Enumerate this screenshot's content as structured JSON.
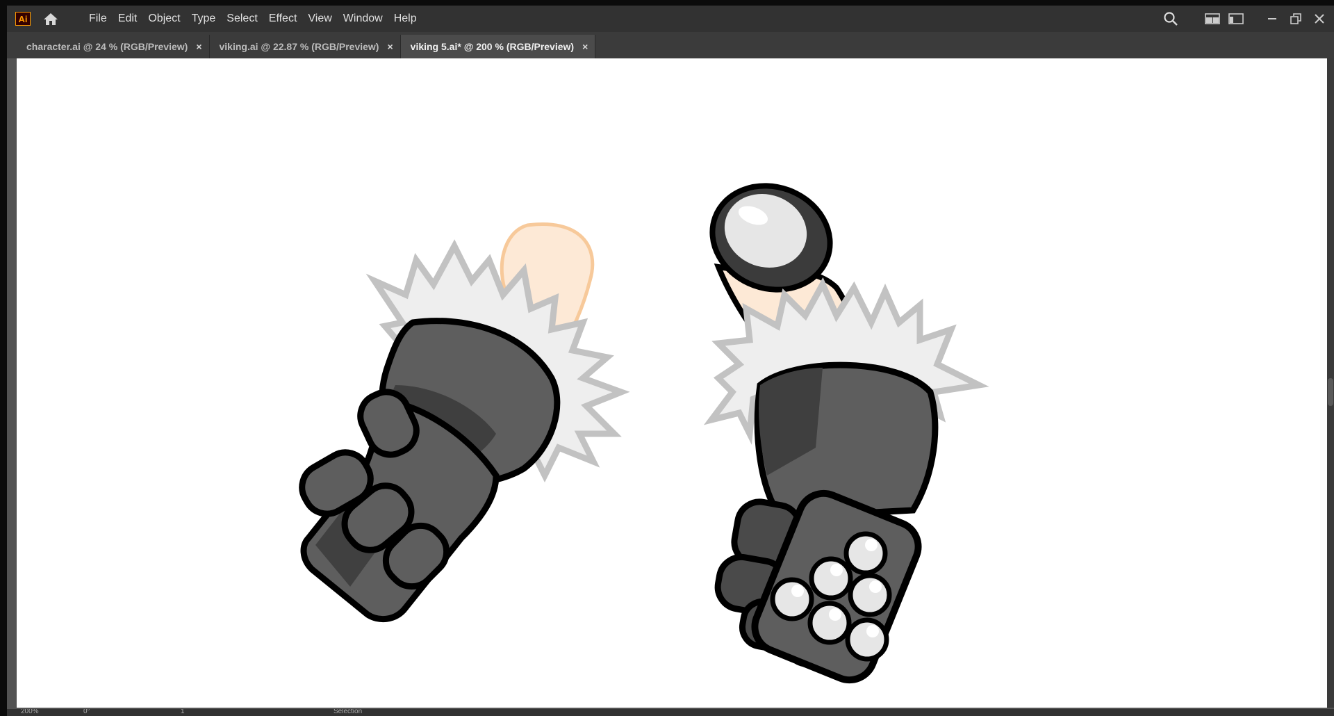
{
  "app": {
    "logo": "Ai"
  },
  "menu": {
    "items": [
      {
        "label": "File"
      },
      {
        "label": "Edit"
      },
      {
        "label": "Object"
      },
      {
        "label": "Type"
      },
      {
        "label": "Select"
      },
      {
        "label": "Effect"
      },
      {
        "label": "View"
      },
      {
        "label": "Window"
      },
      {
        "label": "Help"
      }
    ]
  },
  "tabs": [
    {
      "label": "character.ai @ 24 % (RGB/Preview)",
      "close": "×"
    },
    {
      "label": "viking.ai @ 22.87 % (RGB/Preview)",
      "close": "×"
    },
    {
      "label": "viking 5.ai* @ 200 % (RGB/Preview)",
      "close": "×",
      "active": true
    }
  ],
  "status": {
    "zoom": "200%",
    "rotation": "0°",
    "artboard": "1",
    "tool": "Selection"
  },
  "colors": {
    "skin": "#fde9d6",
    "skin_outline": "#f7c99a",
    "glove_dark": "#3b3b3b",
    "glove_mid": "#5e5e5e",
    "fur": "#c8c8c8",
    "stud": "#e6e6e6"
  },
  "icons": [
    "home-icon",
    "search-icon",
    "arrange-documents-icon",
    "workspace-icon",
    "minimize-icon",
    "restore-icon",
    "close-icon"
  ]
}
